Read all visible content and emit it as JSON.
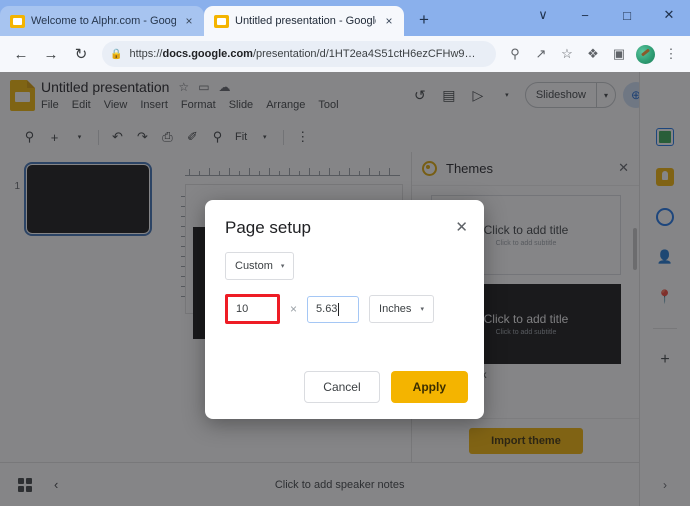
{
  "browser": {
    "tabs": [
      {
        "title": "Welcome to Alphr.com - Google",
        "favicon": "slides-favicon",
        "close": "×",
        "active": false
      },
      {
        "title": "Untitled presentation - Google S",
        "favicon": "slides-favicon",
        "close": "×",
        "active": true
      }
    ],
    "new_tab_label": "+",
    "window_controls": {
      "chevron": "∨",
      "minimize": "−",
      "maximize": "□",
      "close": "✕"
    },
    "nav": {
      "back": "←",
      "forward": "→",
      "reload": "↻"
    },
    "omnibox": {
      "lock": "🔒",
      "url_prefix": "https://",
      "url_domain": "docs.google.com",
      "url_path": "/presentation/d/1HT2ea4S51ctH6ezCFHw9…"
    },
    "omni_icons": {
      "search": "⚲",
      "share": "↗",
      "bookmark": "☆",
      "extensions": "❖",
      "sidepanel": "▣",
      "menu": "⋮"
    }
  },
  "slides": {
    "doc_title": "Untitled presentation",
    "title_icons": {
      "star": "☆",
      "move": "▭",
      "cloud": "☁"
    },
    "menus": [
      "File",
      "Edit",
      "View",
      "Insert",
      "Format",
      "Slide",
      "Arrange",
      "Tool"
    ],
    "header_right": {
      "history_icon": "↺",
      "comment_icon": "▤",
      "meet_icon": "▷",
      "meet_caret": "▾",
      "slideshow_label": "Slideshow",
      "slideshow_caret": "▾",
      "share_icon": "⊕"
    },
    "toolbar": {
      "search": "⚲",
      "new_slide": "+",
      "new_slide_caret": "▾",
      "undo": "↶",
      "redo": "↷",
      "print": "⎙",
      "paint_format": "✐",
      "zoom": "⚲",
      "zoom_level": "Fit",
      "zoom_caret": "▾",
      "more": "⋮",
      "collapse": "⌃"
    },
    "filmstrip": {
      "slides": [
        {
          "number": "1"
        }
      ]
    },
    "themes_panel": {
      "title": "Themes",
      "close": "✕",
      "cards": [
        {
          "title": "Click to add title",
          "subtitle": "Click to add subtitle",
          "name": "",
          "dark": false
        },
        {
          "title": "Click to add title",
          "subtitle": "Click to add subtitle",
          "name": "Simple Dark",
          "dark": true
        }
      ],
      "import_label": "Import theme"
    },
    "sidebar": {
      "items": [
        {
          "icon": "calendar-icon"
        },
        {
          "icon": "keep-icon"
        },
        {
          "icon": "tasks-icon"
        },
        {
          "icon": "contacts-icon"
        },
        {
          "icon": "maps-icon"
        }
      ],
      "add_label": "+",
      "expand_label": "›"
    },
    "notes": {
      "grid_icon": "grid-view-icon",
      "prev_icon": "‹",
      "placeholder": "Click to add speaker notes"
    }
  },
  "dialog": {
    "title": "Page setup",
    "close": "✕",
    "preset": "Custom",
    "preset_caret": "▾",
    "width_value": "10",
    "separator": "×",
    "height_value": "5.63",
    "unit": "Inches",
    "unit_caret": "▾",
    "cancel_label": "Cancel",
    "apply_label": "Apply",
    "highlight_color": "#ee1c25",
    "accent_color": "#f4b400"
  }
}
